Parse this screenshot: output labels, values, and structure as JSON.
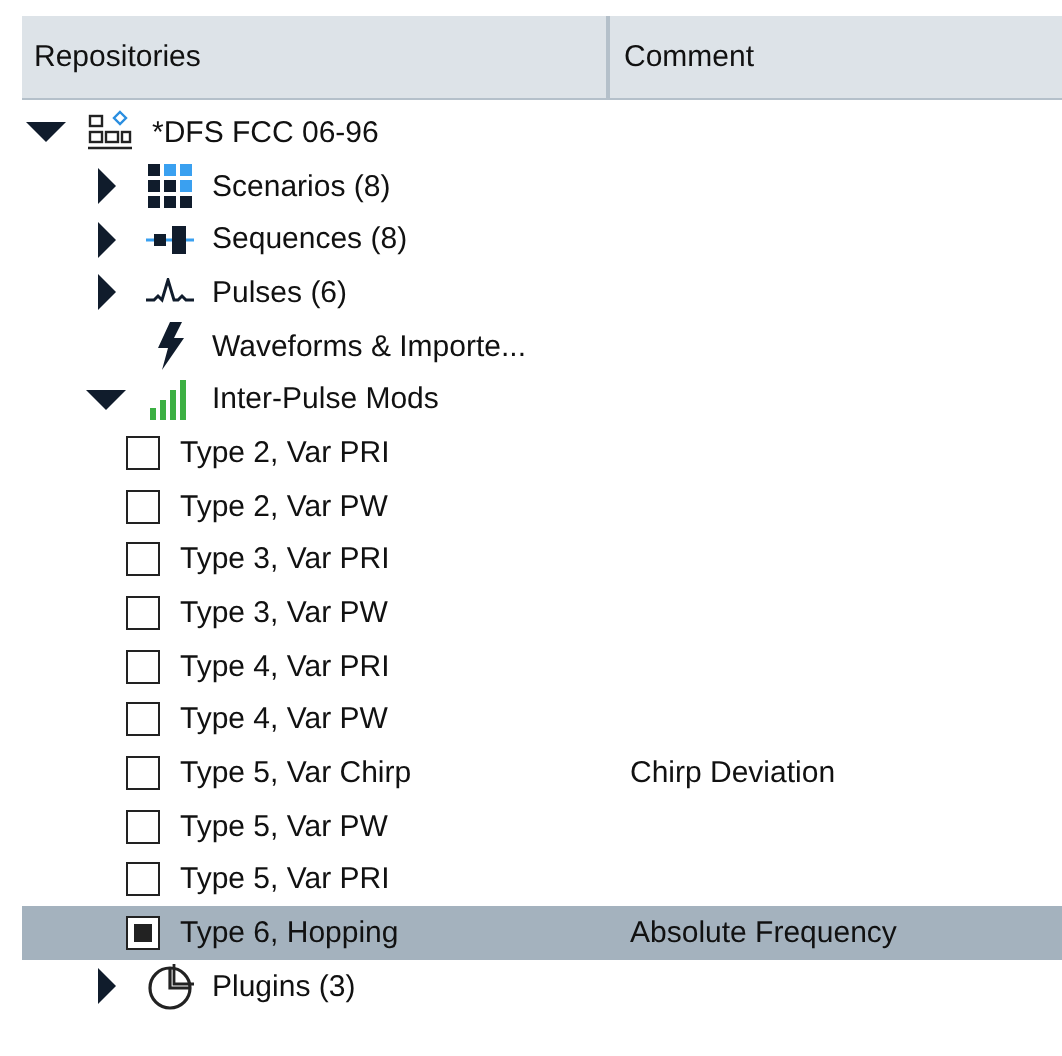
{
  "columns": [
    {
      "label": "Repositories"
    },
    {
      "label": "Comment"
    }
  ],
  "tree": {
    "label": "*DFS FCC 06-96",
    "kind": "folder",
    "expanded": true,
    "selected": false,
    "children": [
      {
        "label": "Scenarios (8)",
        "kind": "folder",
        "expanded": false,
        "selected": false
      },
      {
        "label": "Sequences (8)",
        "kind": "folder",
        "expanded": false,
        "selected": false
      },
      {
        "label": "Pulses (6)",
        "kind": "folder",
        "expanded": false,
        "selected": false
      },
      {
        "label": "Waveforms & Importe...",
        "kind": "leaf",
        "selected": false
      },
      {
        "label": "Inter-Pulse Mods",
        "kind": "folder",
        "expanded": true,
        "selected": false,
        "children": [
          {
            "label": "Type 2, Var PRI",
            "kind": "checkbox",
            "checked": false,
            "selected": false
          },
          {
            "label": "Type 2, Var PW",
            "kind": "checkbox",
            "checked": false,
            "selected": false
          },
          {
            "label": "Type 3, Var PRI",
            "kind": "checkbox",
            "checked": false,
            "selected": false
          },
          {
            "label": "Type 3, Var PW",
            "kind": "checkbox",
            "checked": false,
            "selected": false
          },
          {
            "label": "Type 4, Var PRI",
            "kind": "checkbox",
            "checked": false,
            "selected": false
          },
          {
            "label": "Type 4, Var PW",
            "kind": "checkbox",
            "checked": false,
            "selected": false
          },
          {
            "label": "Type 5, Var Chirp",
            "kind": "checkbox",
            "checked": false,
            "selected": false,
            "comment": "Chirp Deviation"
          },
          {
            "label": "Type 5, Var PW",
            "kind": "checkbox",
            "checked": false,
            "selected": false
          },
          {
            "label": "Type 5, Var PRI",
            "kind": "checkbox",
            "checked": false,
            "selected": false
          },
          {
            "label": "Type 6, Hopping",
            "kind": "checkbox",
            "checked": true,
            "selected": true,
            "comment": "Absolute Frequency"
          }
        ]
      },
      {
        "label": "Plugins (3)",
        "kind": "folder",
        "expanded": false,
        "selected": false
      }
    ]
  }
}
